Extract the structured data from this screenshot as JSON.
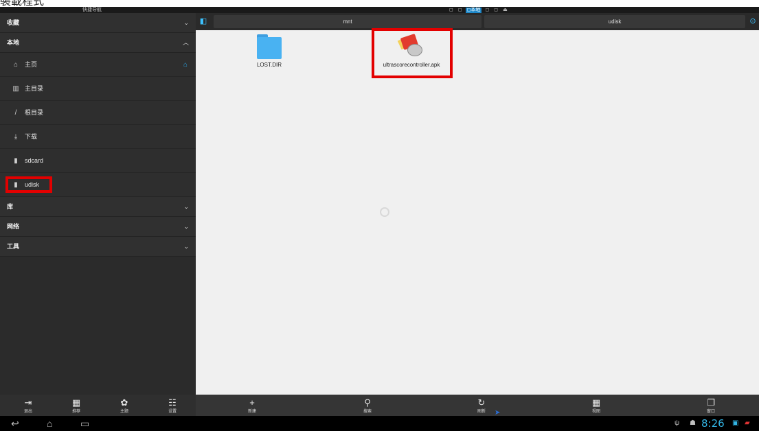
{
  "caption": "裝載程式",
  "topbar": {
    "title": "快捷导航",
    "status_items": [
      {
        "label": "◻",
        "active": false
      },
      {
        "label": "◻",
        "active": false
      },
      {
        "label": "◻本地",
        "active": true
      },
      {
        "label": "◻",
        "active": false
      },
      {
        "label": "◻",
        "active": false
      },
      {
        "label": "⏏",
        "active": false
      }
    ]
  },
  "sidebar": {
    "sections": {
      "favorites": {
        "label": "收藏",
        "chevron": "⌄"
      },
      "local": {
        "label": "本地",
        "chevron": "︿"
      },
      "library": {
        "label": "库",
        "chevron": "⌄"
      },
      "network": {
        "label": "网络",
        "chevron": "⌄"
      },
      "tools": {
        "label": "工具",
        "chevron": "⌄"
      }
    },
    "local_items": [
      {
        "label": "主页",
        "icon": "⌂"
      },
      {
        "label": "主目录",
        "icon": "▥"
      },
      {
        "label": "根目录",
        "icon": "/"
      },
      {
        "label": "下载",
        "icon": "⤓"
      },
      {
        "label": "sdcard",
        "icon": "▮"
      },
      {
        "label": "udisk",
        "icon": "▮"
      }
    ],
    "home_action_icon": "⌂",
    "toolbar": [
      {
        "label": "退出",
        "icon": "⇥"
      },
      {
        "label": "推荐",
        "icon": "▦"
      },
      {
        "label": "主题",
        "icon": "✿"
      },
      {
        "label": "设置",
        "icon": "☷"
      }
    ]
  },
  "pathbar": {
    "crumbs": [
      "mnt",
      "udisk"
    ]
  },
  "files": [
    {
      "name": "LOST.DIR",
      "type": "folder"
    },
    {
      "name": "ultrascorecontroller.apk",
      "type": "apk"
    }
  ],
  "main_toolbar": [
    {
      "label": "新建",
      "icon": "+"
    },
    {
      "label": "搜索",
      "icon": "⚲"
    },
    {
      "label": "刷新",
      "icon": "↻"
    },
    {
      "label": "视图",
      "icon": "▦"
    },
    {
      "label": "窗口",
      "icon": "❐"
    }
  ],
  "navbar": {
    "back": "↩",
    "home": "⌂",
    "recent": "▭",
    "usb": "ψ",
    "android": "☗",
    "time": "8:26",
    "battery": "▰"
  },
  "colors": {
    "accent": "#33b5e5",
    "sidebar_bg": "#2b2b2b",
    "content_bg": "#f0f0f0",
    "highlight": "#e30000",
    "folder": "#49b2f2"
  }
}
